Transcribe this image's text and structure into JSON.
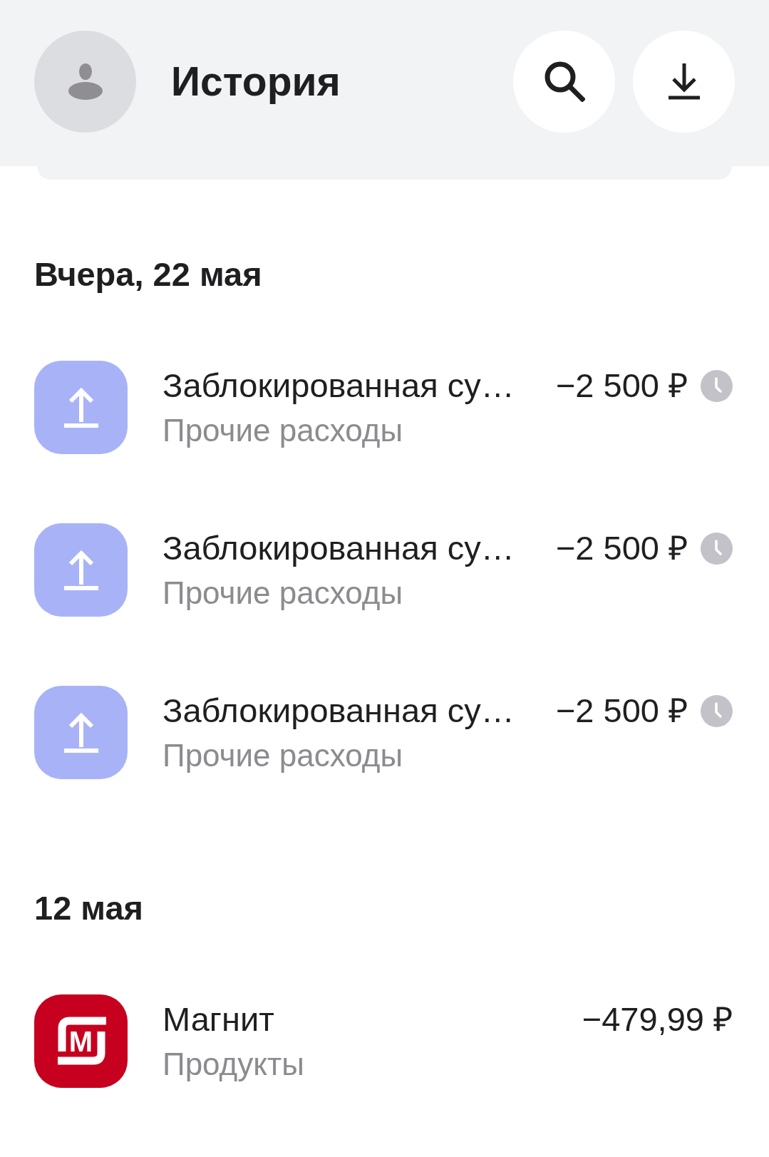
{
  "top_bar": {
    "title": "История"
  },
  "sections": [
    {
      "date": "Вчера, 22 мая",
      "transactions": [
        {
          "kind": "transfer",
          "title": "Заблокированная су…",
          "category": "Прочие расходы",
          "amount": "−2 500 ₽",
          "pending": true
        },
        {
          "kind": "transfer",
          "title": "Заблокированная су…",
          "category": "Прочие расходы",
          "amount": "−2 500 ₽",
          "pending": true
        },
        {
          "kind": "transfer",
          "title": "Заблокированная су…",
          "category": "Прочие расходы",
          "amount": "−2 500 ₽",
          "pending": true
        }
      ]
    },
    {
      "date": "12 мая",
      "transactions": [
        {
          "kind": "store",
          "logo_text": "М",
          "title": "Магнит",
          "category": "Продукты",
          "amount": "−479,99 ₽",
          "pending": false
        }
      ]
    }
  ]
}
